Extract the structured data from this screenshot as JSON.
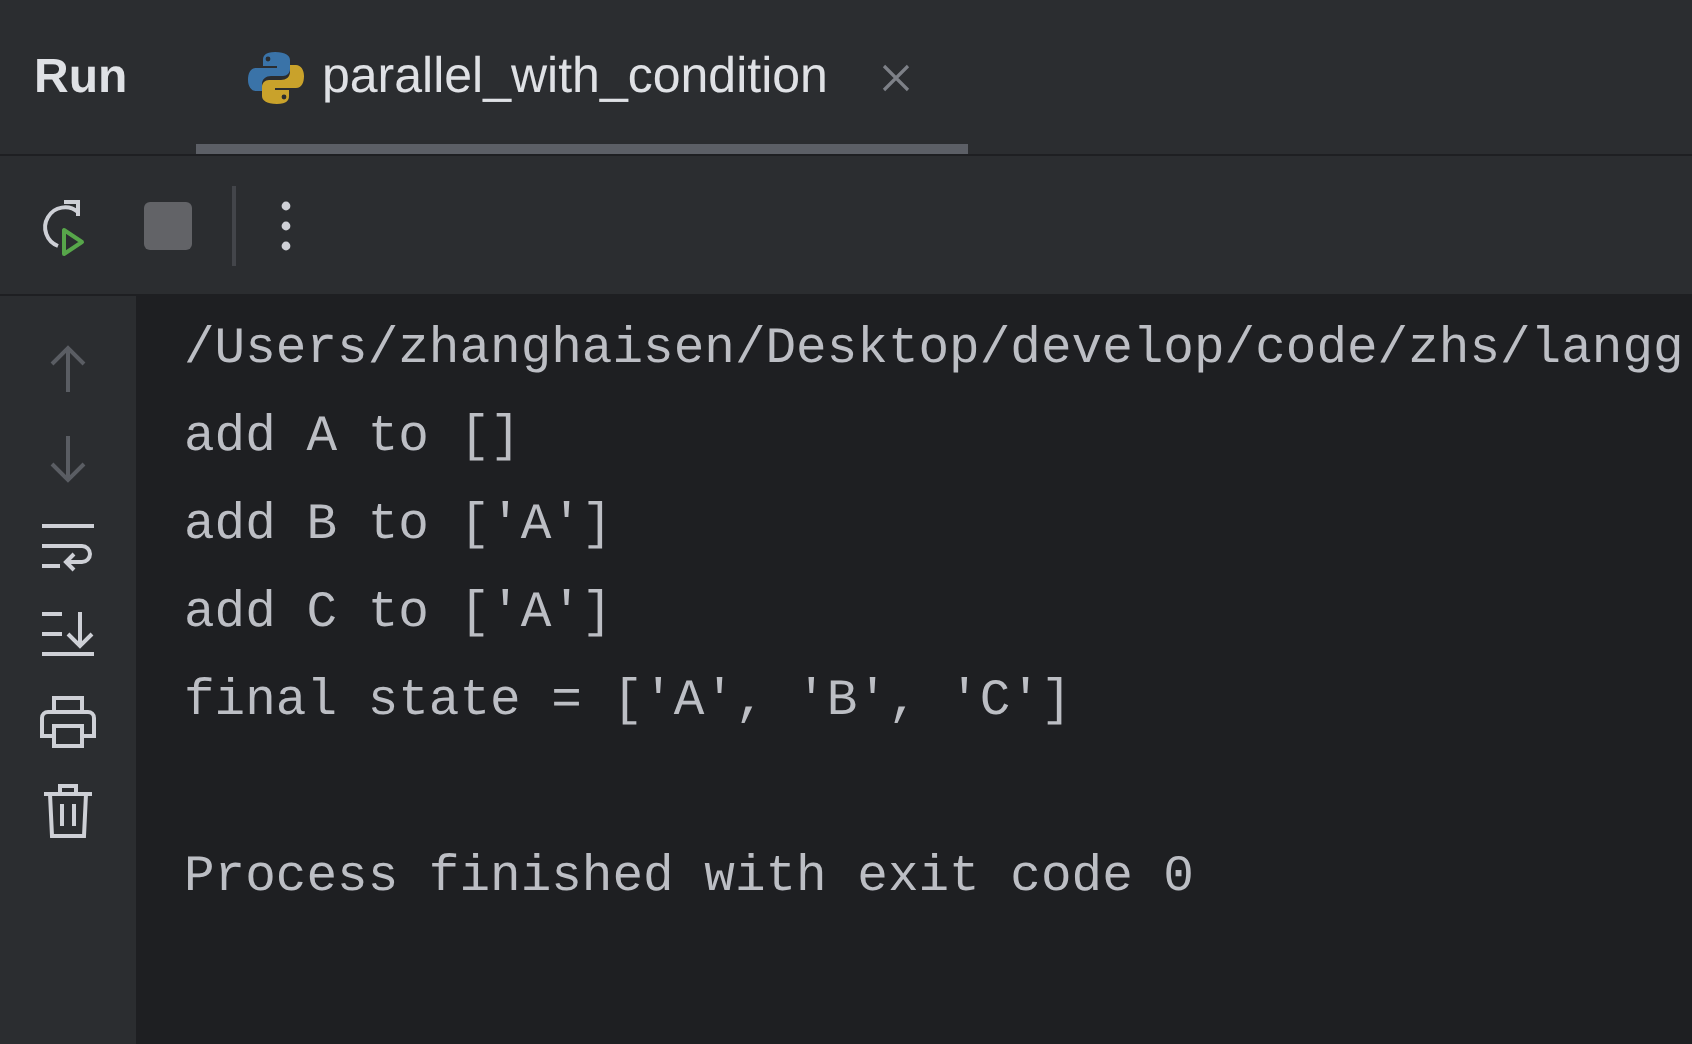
{
  "panel": {
    "title": "Run"
  },
  "tabs": [
    {
      "label": "parallel_with_condition",
      "selected": true
    }
  ],
  "toolbar": [
    {
      "kind": "rerun"
    },
    {
      "kind": "stop"
    },
    {
      "kind": "more"
    }
  ],
  "sidebar": [
    {
      "kind": "up",
      "disabled": true
    },
    {
      "kind": "down",
      "disabled": true
    },
    {
      "kind": "wrap",
      "disabled": false
    },
    {
      "kind": "scroll-end",
      "disabled": false
    },
    {
      "kind": "print",
      "disabled": false
    },
    {
      "kind": "trash",
      "disabled": false
    }
  ],
  "console": {
    "lines": [
      "/Users/zhanghaisen/Desktop/develop/code/zhs/langg",
      "add A to []",
      "add B to ['A']",
      "add C to ['A']",
      "final state = ['A', 'B', 'C']"
    ],
    "exit_message": "Process finished with exit code 0"
  }
}
